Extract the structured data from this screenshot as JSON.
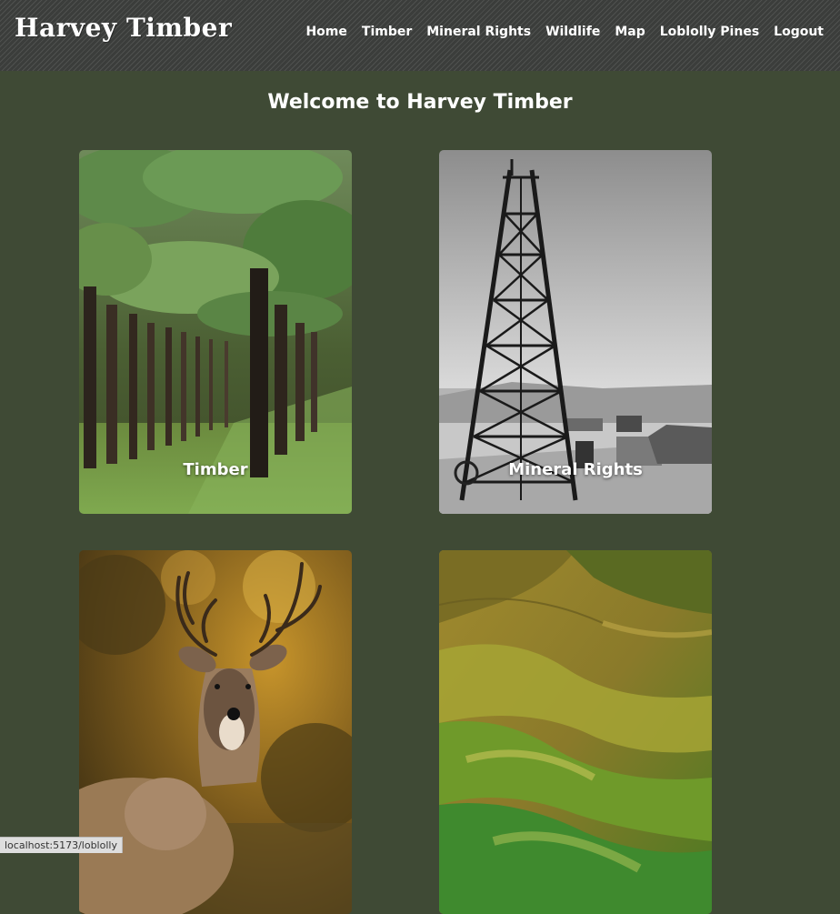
{
  "header": {
    "logo": "Harvey Timber",
    "nav": [
      "Home",
      "Timber",
      "Mineral Rights",
      "Wildlife",
      "Map",
      "Loblolly Pines",
      "Logout"
    ]
  },
  "main": {
    "title": "Welcome to Harvey Timber",
    "cards": [
      {
        "label": "Timber",
        "image": "pine-forest-photo"
      },
      {
        "label": "Mineral Rights",
        "image": "oil-derrick-photo"
      },
      {
        "label": "",
        "image": "whitetail-deer-photo"
      },
      {
        "label": "",
        "image": "aerial-terrain-map"
      }
    ]
  },
  "status_bar": {
    "url": "localhost:5173/loblolly"
  },
  "colors": {
    "page_bg": "#3f4a35",
    "header_bg": "#3b3d3b",
    "text": "#ffffff"
  }
}
